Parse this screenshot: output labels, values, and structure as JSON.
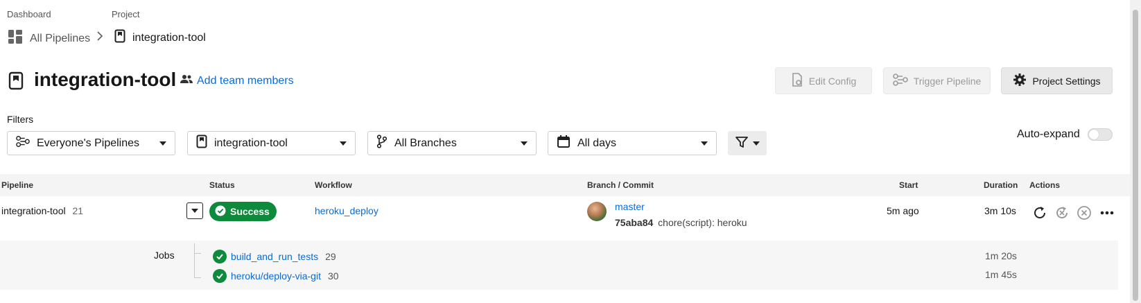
{
  "breadcrumb": {
    "dashboard_label": "Dashboard",
    "project_label": "Project",
    "all_pipelines": "All Pipelines",
    "project_name": "integration-tool"
  },
  "header": {
    "title": "integration-tool",
    "add_team_members": "Add team members",
    "edit_config": "Edit Config",
    "trigger_pipeline": "Trigger Pipeline",
    "project_settings": "Project Settings"
  },
  "filters": {
    "label": "Filters",
    "pipelines": "Everyone's Pipelines",
    "project": "integration-tool",
    "branches": "All Branches",
    "days": "All days",
    "auto_expand": "Auto-expand",
    "auto_expand_on": false
  },
  "table": {
    "headers": {
      "pipeline": "Pipeline",
      "status": "Status",
      "workflow": "Workflow",
      "branch_commit": "Branch / Commit",
      "start": "Start",
      "duration": "Duration",
      "actions": "Actions"
    },
    "row": {
      "pipeline_name": "integration-tool",
      "pipeline_number": "21",
      "status": "Success",
      "workflow": "heroku_deploy",
      "branch": "master",
      "commit_hash": "75aba84",
      "commit_message": "chore(script): heroku",
      "start": "5m ago",
      "duration": "3m 10s"
    },
    "jobs": {
      "label": "Jobs",
      "items": [
        {
          "name": "build_and_run_tests",
          "number": "29",
          "duration": "1m 20s"
        },
        {
          "name": "heroku/deploy-via-git",
          "number": "30",
          "duration": "1m 45s"
        }
      ]
    }
  },
  "colors": {
    "accent": "#0a6bd6",
    "success": "#0d8a3c"
  }
}
